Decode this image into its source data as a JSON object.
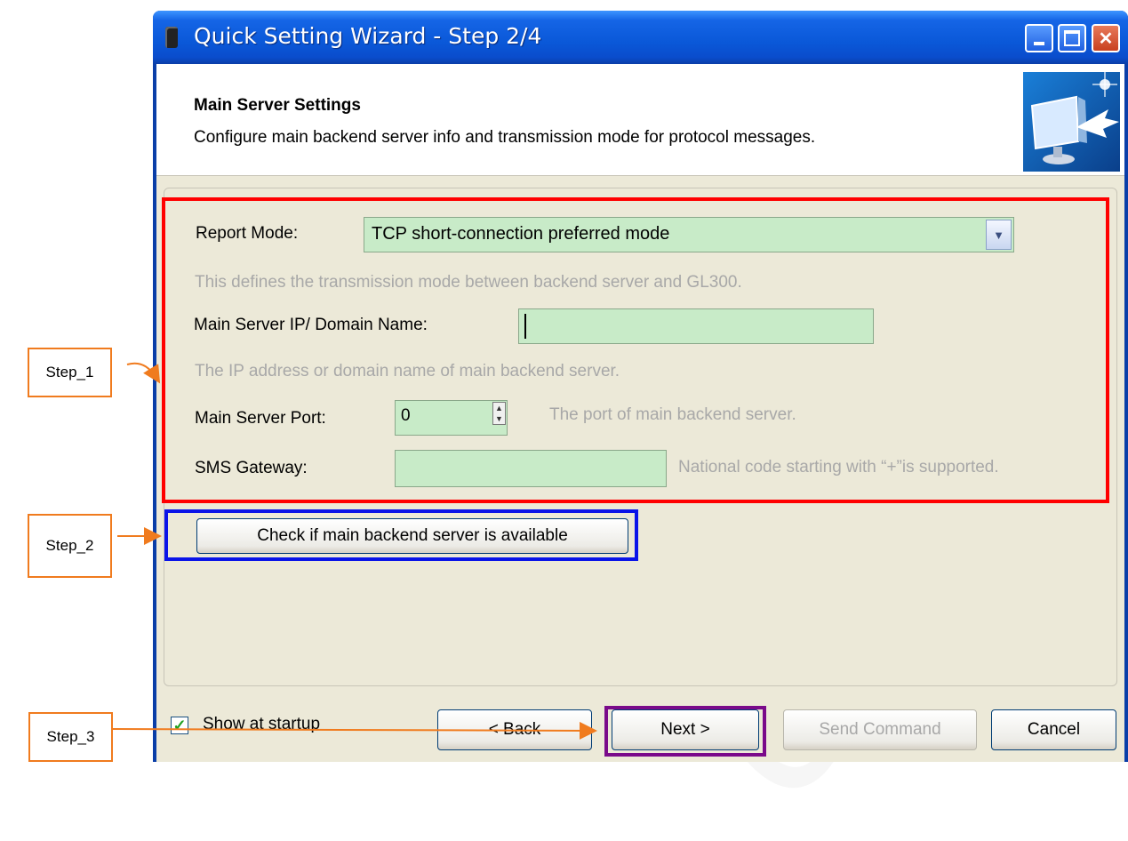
{
  "window": {
    "title": "Quick Setting Wizard - Step 2/4"
  },
  "header": {
    "title": "Main Server Settings",
    "description": "Configure main backend server info and transmission mode for protocol messages."
  },
  "form": {
    "report_mode_label": "Report Mode:",
    "report_mode_value": "TCP short-connection preferred mode",
    "report_mode_help": "This defines the transmission mode between backend server and GL300.",
    "server_ip_label": "Main Server IP/ Domain Name:",
    "server_ip_value": "",
    "server_ip_help": "The IP address or domain name of main backend server.",
    "server_port_label": "Main Server Port:",
    "server_port_value": "0",
    "server_port_help": "The port of main backend server.",
    "sms_gateway_label": "SMS Gateway:",
    "sms_gateway_value": "",
    "sms_gateway_help": "National code starting with “+”is supported.",
    "check_button_label": "Check if main backend server is available"
  },
  "footer": {
    "show_at_startup_label": "Show at startup",
    "show_at_startup_checked": true,
    "back_label": "< Back",
    "next_label": "Next >",
    "send_command_label": "Send Command",
    "cancel_label": "Cancel"
  },
  "annotations": {
    "step1": "Step_1",
    "step2": "Step_2",
    "step3": "Step_3",
    "colors": {
      "step1_box": "#ff0000",
      "step2_box": "#0a14e8",
      "step3_box": "#7a0a8a",
      "arrow": "#f07b1e"
    }
  }
}
